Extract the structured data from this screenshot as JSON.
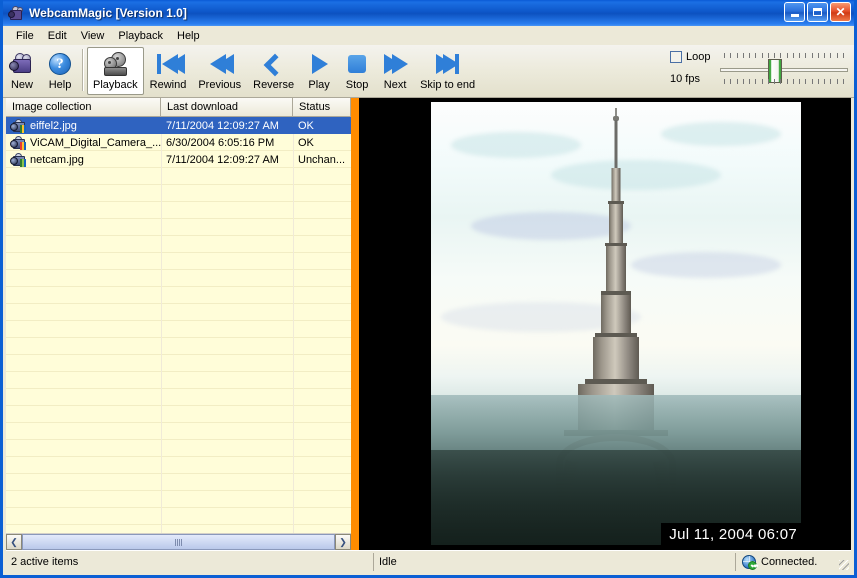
{
  "window": {
    "title": "WebcamMagic [Version 1.0]",
    "app_icon": "camcorder-icon",
    "controls": {
      "minimize": "minimize-button",
      "maximize": "maximize-button",
      "close": "close-button"
    }
  },
  "menu": {
    "items": [
      {
        "label": "File"
      },
      {
        "label": "Edit"
      },
      {
        "label": "View"
      },
      {
        "label": "Playback"
      },
      {
        "label": "Help"
      }
    ]
  },
  "toolbar": {
    "buttons": [
      {
        "label": "New",
        "icon": "camcorder-icon",
        "pressed": false
      },
      {
        "label": "Help",
        "icon": "question-circle-icon",
        "pressed": false
      },
      {
        "label": "Playback",
        "icon": "film-projector-icon",
        "pressed": true
      },
      {
        "label": "Rewind",
        "icon": "rewind-icon",
        "pressed": false
      },
      {
        "label": "Previous",
        "icon": "previous-icon",
        "pressed": false
      },
      {
        "label": "Reverse",
        "icon": "reverse-icon",
        "pressed": false
      },
      {
        "label": "Play",
        "icon": "play-icon",
        "pressed": false
      },
      {
        "label": "Stop",
        "icon": "stop-icon",
        "pressed": false
      },
      {
        "label": "Next",
        "icon": "next-icon",
        "pressed": false
      },
      {
        "label": "Skip to end",
        "icon": "skip-to-end-icon",
        "pressed": false
      }
    ],
    "loop": {
      "label": "Loop",
      "checked": false
    },
    "fps": {
      "label": "10 fps",
      "value": 10,
      "slider_position_percent": 40
    },
    "accent_color": "#2f7fd8"
  },
  "list": {
    "columns": [
      {
        "label": "Image collection"
      },
      {
        "label": "Last download"
      },
      {
        "label": "Status"
      }
    ],
    "rows": [
      {
        "name": "eiffel2.jpg",
        "last_download": "7/11/2004 12:09:27 AM",
        "status": "OK",
        "selected": true,
        "icon": "webcam-item-icon"
      },
      {
        "name": "ViCAM_Digital_Camera_...",
        "last_download": "6/30/2004 6:05:16 PM",
        "status": "OK",
        "selected": false,
        "icon": "webcam-item-icon"
      },
      {
        "name": "netcam.jpg",
        "last_download": "7/11/2004 12:09:27 AM",
        "status": "Unchan...",
        "selected": false,
        "icon": "webcam-item-icon"
      }
    ],
    "background_color": "#fffdd9",
    "selection_color": "#2f63c0",
    "scroll_left_icon": "chevron-left-icon",
    "scroll_right_icon": "chevron-right-icon"
  },
  "splitter": {
    "color": "#ff8c00"
  },
  "viewer": {
    "background_color": "#000000",
    "image_alt": "eiffel-tower-webcam-photo",
    "timestamp": "Jul 11, 2004 06:07"
  },
  "statusbar": {
    "items": "2 active items",
    "state": "Idle",
    "connection": "Connected.",
    "connection_icon": "globe-check-icon"
  }
}
